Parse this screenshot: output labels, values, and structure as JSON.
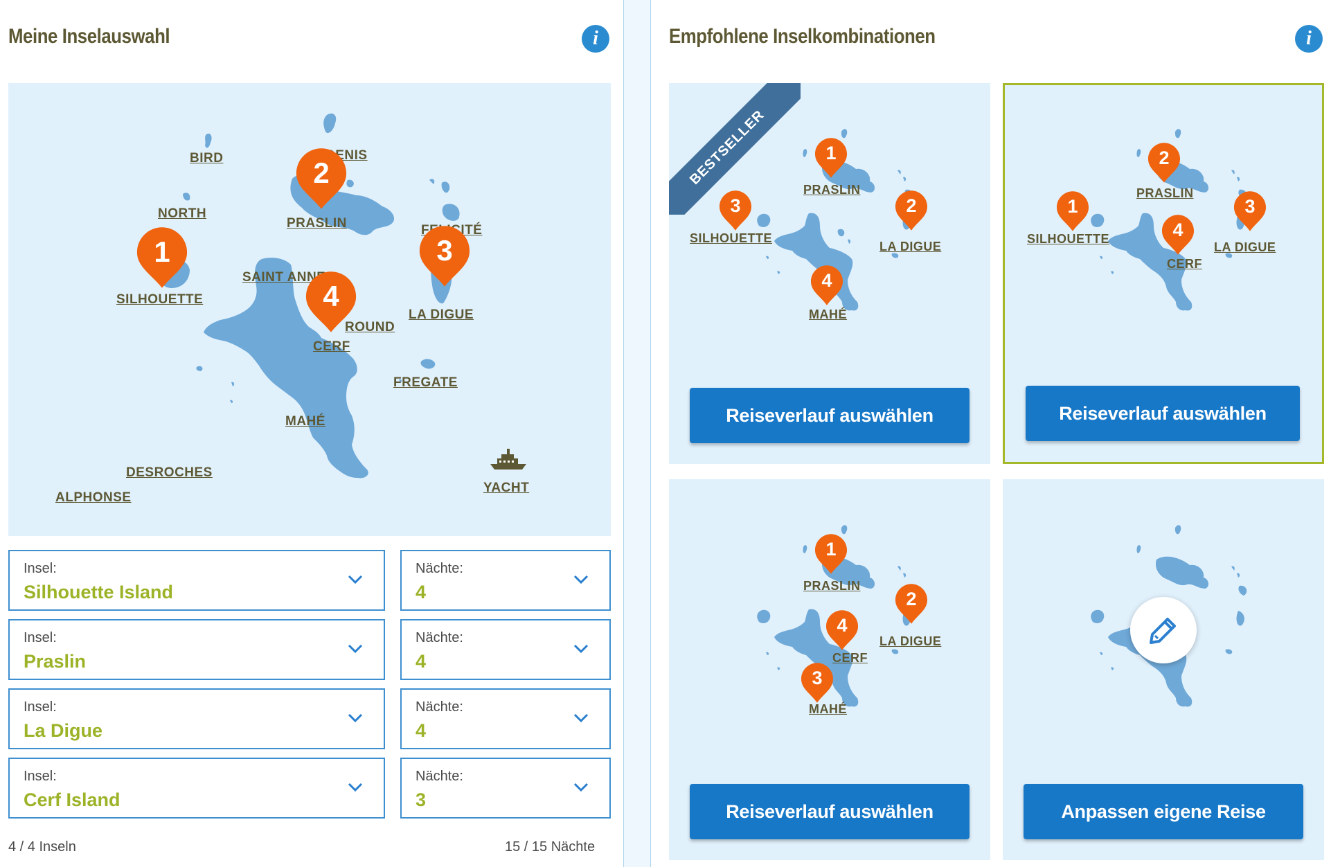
{
  "left": {
    "title": "Meine Inselauswahl",
    "info_icon": "info-icon",
    "map": {
      "labels": {
        "bird": "BIRD",
        "denis": "DENIS",
        "north": "NORTH",
        "praslin": "PRASLIN",
        "felicite": "FELICITÉ",
        "silhouette": "SILHOUETTE",
        "saint_anne": "SAINT ANNE",
        "round": "ROUND",
        "la_digue": "LA DIGUE",
        "cerf": "CERF",
        "fregate": "FREGATE",
        "mahe": "MAHÉ",
        "desroches": "DESROCHES",
        "alphonse": "ALPHONSE",
        "yacht": "YACHT"
      },
      "pins": [
        "1",
        "2",
        "3",
        "4"
      ],
      "yacht_icon": "ship-icon"
    },
    "selections": [
      {
        "island_caption": "Insel:",
        "island": "Silhouette Island",
        "nights_caption": "Nächte:",
        "nights": "4"
      },
      {
        "island_caption": "Insel:",
        "island": "Praslin",
        "nights_caption": "Nächte:",
        "nights": "4"
      },
      {
        "island_caption": "Insel:",
        "island": "La Digue",
        "nights_caption": "Nächte:",
        "nights": "4"
      },
      {
        "island_caption": "Insel:",
        "island": "Cerf Island",
        "nights_caption": "Nächte:",
        "nights": "3"
      }
    ],
    "footer": {
      "islands_count": "4 / 4 Inseln",
      "nights_count": "15 / 15 Nächte"
    }
  },
  "right": {
    "title": "Empfohlene Inselkombinationen",
    "info_icon": "info-icon",
    "cards": [
      {
        "ribbon": "BESTSELLER",
        "labels": {
          "praslin": "PRASLIN",
          "silhouette": "SILHOUETTE",
          "la_digue": "LA DIGUE",
          "mahe": "MAHÉ"
        },
        "pins": {
          "praslin": "1",
          "la_digue": "2",
          "silhouette": "3",
          "mahe": "4"
        },
        "button": "Reiseverlauf auswählen",
        "selected": false
      },
      {
        "labels": {
          "praslin": "PRASLIN",
          "silhouette": "SILHOUETTE",
          "la_digue": "LA DIGUE",
          "cerf": "CERF"
        },
        "pins": {
          "silhouette": "1",
          "praslin": "2",
          "la_digue": "3",
          "cerf": "4"
        },
        "button": "Reiseverlauf auswählen",
        "selected": true
      },
      {
        "labels": {
          "praslin": "PRASLIN",
          "la_digue": "LA DIGUE",
          "cerf": "CERF",
          "mahe": "MAHÉ"
        },
        "pins": {
          "praslin": "1",
          "la_digue": "2",
          "mahe": "3",
          "cerf": "4"
        },
        "button": "Reiseverlauf auswählen",
        "selected": false
      },
      {
        "edit_icon": "pencil-icon",
        "button": "Anpassen eigene Reise",
        "selected": false
      }
    ]
  },
  "colors": {
    "accent_blue": "#1878c8",
    "pin_orange": "#f0630f",
    "value_green": "#9bb327",
    "title_olive": "#5d5834",
    "map_bg": "#e1f1fc",
    "island_blue": "#6fa9d8",
    "selected_border": "#a4b829"
  }
}
